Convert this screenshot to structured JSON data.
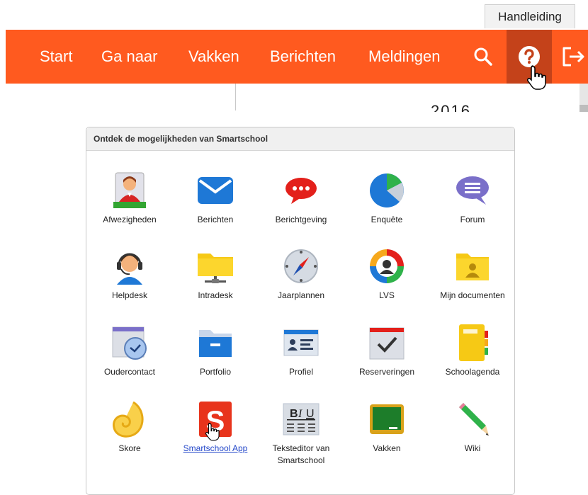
{
  "tooltip": {
    "text": "Handleiding"
  },
  "nav": {
    "items": [
      {
        "label": "Start"
      },
      {
        "label": "Ga naar"
      },
      {
        "label": "Vakken"
      },
      {
        "label": "Berichten"
      },
      {
        "label": "Meldingen"
      }
    ],
    "icons": [
      "search-icon",
      "help-icon",
      "logout-icon"
    ]
  },
  "panel": {
    "title": "Ontdek de mogelijkheden van Smartschool",
    "apps": [
      {
        "label": "Afwezigheden",
        "icon": "absence-person-icon"
      },
      {
        "label": "Berichten",
        "icon": "envelope-icon"
      },
      {
        "label": "Berichtgeving",
        "icon": "chat-bubble-icon"
      },
      {
        "label": "Enquête",
        "icon": "pie-chart-icon"
      },
      {
        "label": "Forum",
        "icon": "forum-bubble-icon"
      },
      {
        "label": "Helpdesk",
        "icon": "headset-person-icon"
      },
      {
        "label": "Intradesk",
        "icon": "network-folder-icon"
      },
      {
        "label": "Jaarplannen",
        "icon": "compass-icon"
      },
      {
        "label": "LVS",
        "icon": "student-tracking-icon"
      },
      {
        "label": "Mijn documenten",
        "icon": "personal-folder-icon"
      },
      {
        "label": "Oudercontact",
        "icon": "calendar-clock-icon"
      },
      {
        "label": "Portfolio",
        "icon": "blue-folder-icon"
      },
      {
        "label": "Profiel",
        "icon": "id-card-icon"
      },
      {
        "label": "Reserveringen",
        "icon": "calendar-check-icon"
      },
      {
        "label": "Schoolagenda",
        "icon": "yellow-notebook-icon"
      },
      {
        "label": "Skore",
        "icon": "shell-icon"
      },
      {
        "label": "Smartschool App",
        "icon": "smartschool-s-icon"
      },
      {
        "label": "Teksteditor van Smartschool",
        "icon": "text-editor-icon"
      },
      {
        "label": "Vakken",
        "icon": "chalkboard-icon"
      },
      {
        "label": "Wiki",
        "icon": "pencil-icon"
      }
    ]
  },
  "partial_text": "2016"
}
